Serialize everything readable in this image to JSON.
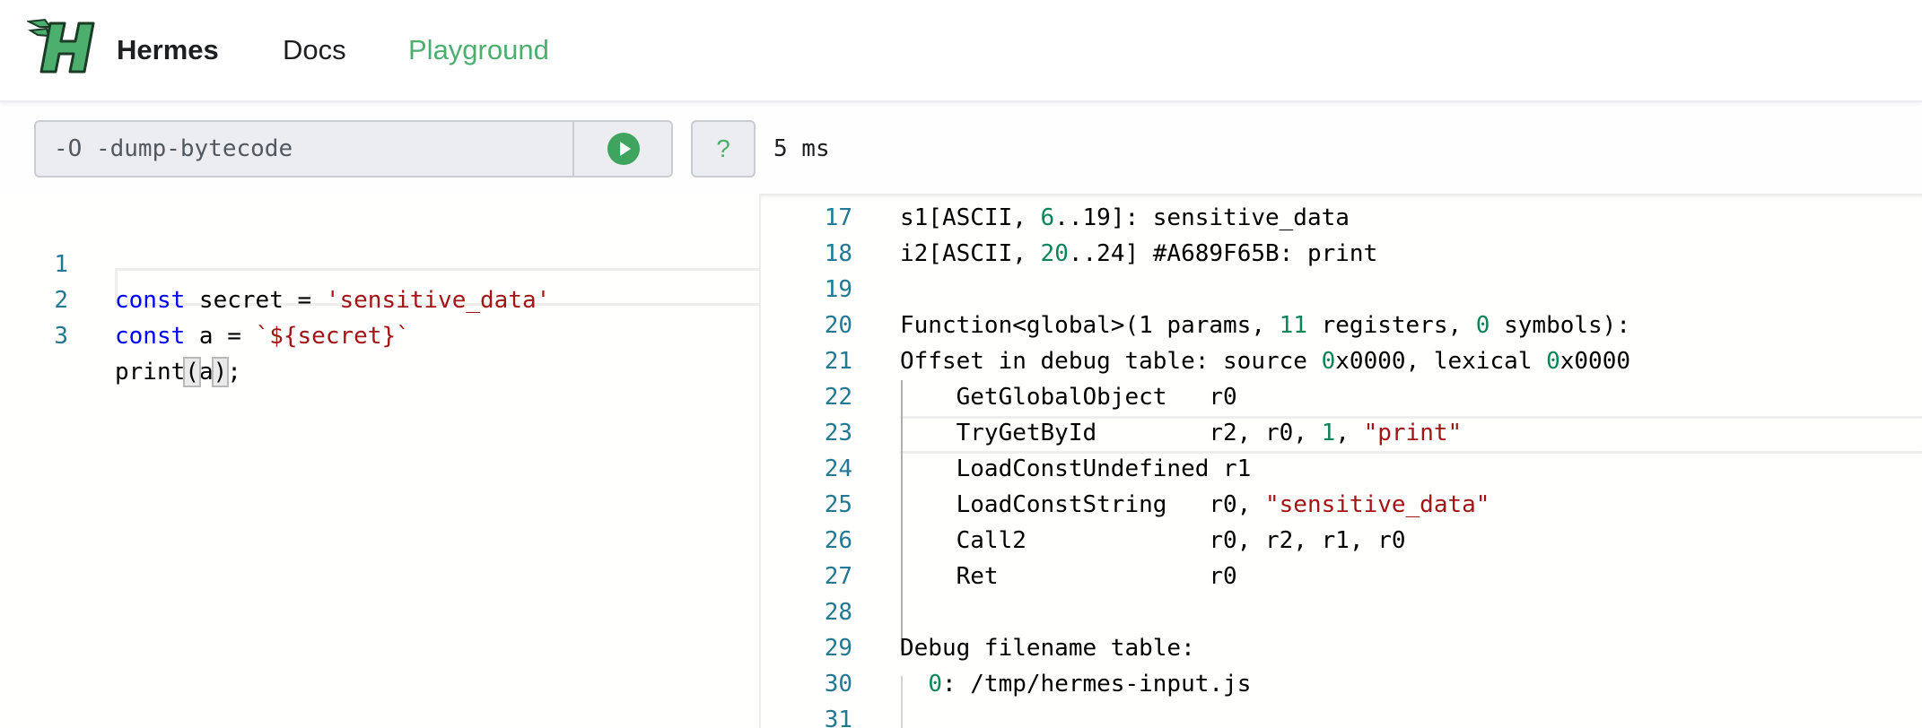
{
  "navbar": {
    "brand": "Hermes",
    "links": [
      "Docs",
      "Playground"
    ],
    "logo_icon": "hermes-winged-h-logo",
    "active_link_color": "#4caf6e"
  },
  "toolbar": {
    "flags_value": "-O -dump-bytecode",
    "run_icon": "play-circle-icon",
    "help_label": "?",
    "timing": "5 ms"
  },
  "editor": {
    "lines": [
      {
        "n": "1",
        "kw": "const",
        "rest": " secret = ",
        "str": "'sensitive_data'"
      },
      {
        "n": "2",
        "kw": "const",
        "rest": " a = ",
        "str": "`${secret}`"
      },
      {
        "n": "3",
        "text_a": "print",
        "b1": "(",
        "arg": "a",
        "b2": ")",
        "tail": ";"
      }
    ]
  },
  "output": {
    "lines": [
      {
        "n": "17",
        "parts": [
          [
            "s1[ASCII, ",
            ""
          ],
          [
            "6",
            "num"
          ],
          [
            "..19]: sensitive_data",
            ""
          ]
        ]
      },
      {
        "n": "18",
        "parts": [
          [
            "i2[ASCII, ",
            ""
          ],
          [
            "20",
            "num"
          ],
          [
            "..24] #A689F65B: print",
            ""
          ]
        ]
      },
      {
        "n": "19",
        "parts": []
      },
      {
        "n": "20",
        "parts": [
          [
            "Function<global>(1 params, ",
            ""
          ],
          [
            "11",
            "num"
          ],
          [
            " registers, ",
            ""
          ],
          [
            "0",
            "num"
          ],
          [
            " symbols):",
            ""
          ]
        ]
      },
      {
        "n": "21",
        "parts": [
          [
            "Offset in debug table: source ",
            ""
          ],
          [
            "0",
            "num"
          ],
          [
            "x0000, lexical ",
            ""
          ],
          [
            "0",
            "num"
          ],
          [
            "x0000",
            ""
          ]
        ]
      },
      {
        "n": "22",
        "parts": [
          [
            "    GetGlobalObject   r0",
            ""
          ]
        ]
      },
      {
        "n": "23",
        "parts": [
          [
            "    TryGetById        r2, r0, ",
            ""
          ],
          [
            "1",
            "num"
          ],
          [
            ", ",
            ""
          ],
          [
            "\"print\"",
            "ostr"
          ]
        ]
      },
      {
        "n": "24",
        "parts": [
          [
            "    LoadConstUndefined r1",
            ""
          ]
        ]
      },
      {
        "n": "25",
        "parts": [
          [
            "    LoadConstString   r0, ",
            ""
          ],
          [
            "\"sensitive_data\"",
            "ostr"
          ]
        ]
      },
      {
        "n": "26",
        "parts": [
          [
            "    Call2             r0, r2, r1, r0",
            ""
          ]
        ]
      },
      {
        "n": "27",
        "parts": [
          [
            "    Ret               r0",
            ""
          ]
        ]
      },
      {
        "n": "28",
        "parts": []
      },
      {
        "n": "29",
        "parts": [
          [
            "Debug filename table:",
            ""
          ]
        ]
      },
      {
        "n": "30",
        "parts": [
          [
            "  ",
            ""
          ],
          [
            "0",
            "num"
          ],
          [
            ": /tmp/hermes-input.js",
            ""
          ]
        ]
      },
      {
        "n": "31",
        "parts": []
      }
    ]
  }
}
